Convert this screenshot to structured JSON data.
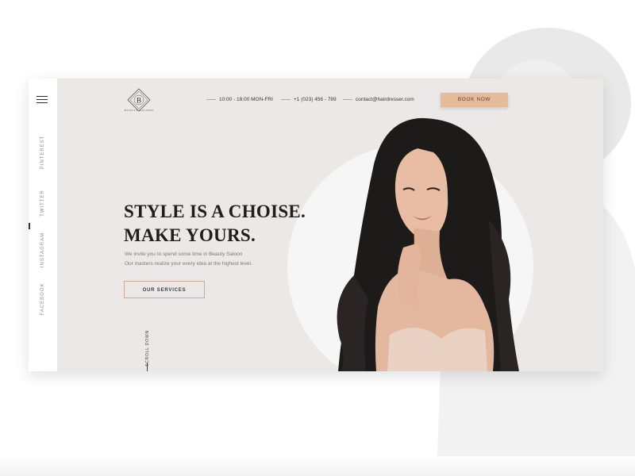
{
  "header": {
    "logo_letter": "B",
    "logo_text": "BEAUTY SALOON",
    "hours": "10:00 - 18:00 MON-FRI",
    "phone": "+1 (023) 456 - 789",
    "email": "contact@hairdresser.com",
    "book_label": "BOOK NOW"
  },
  "sidebar": {
    "social": [
      "PINTEREST",
      "TWITTER",
      "INSTAGRAM",
      "FACEBOOK"
    ]
  },
  "hero": {
    "headline_line1": "STYLE IS A CHOISE.",
    "headline_line2": "MAKE YOURS.",
    "subtext_line1": "We invite you to spend some time in Beauty Saloon",
    "subtext_line2": "Our masters realize your every idea at the highest level.",
    "services_label": "OUR SERVICES",
    "scroll_label": "SCROLL DOWN"
  },
  "colors": {
    "accent": "#e6bb97",
    "card_bg": "#ece8e7",
    "text_dark": "#1e1e1e"
  },
  "icons": {
    "menu": "hamburger-icon",
    "logo": "diamond-logo-icon"
  }
}
